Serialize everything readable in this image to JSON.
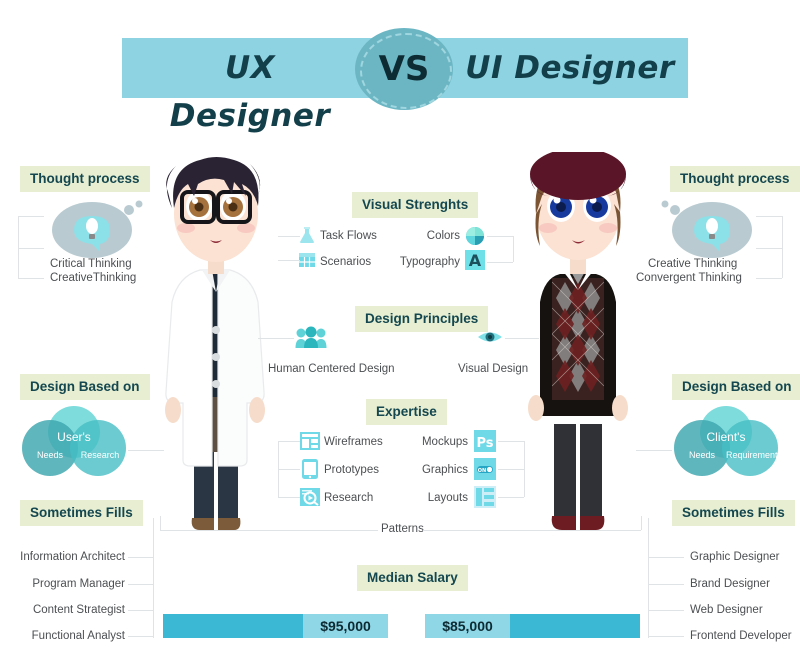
{
  "header": {
    "left_title": "UX Designer",
    "right_title": "UI Designer",
    "vs": "VS",
    "bar_color": "#8ed3e2",
    "circle_color": "#6cb6c4"
  },
  "chips": {
    "thought_process_left": "Thought process",
    "thought_process_right": "Thought process",
    "visual_strengths": "Visual Strenghts",
    "design_principles": "Design Principles",
    "design_based_on_left": "Design Based on",
    "design_based_on_right": "Design Based on",
    "expertise": "Expertise",
    "sometimes_fills_left": "Sometimes Fills",
    "sometimes_fills_right": "Sometimes Fills",
    "median_salary": "Median Salary",
    "chip_bg": "#e7eed1",
    "chip_text": "#14474f"
  },
  "thought_process": {
    "left_items": [
      "Critical Thinking",
      "CreativeThinking"
    ],
    "right_items": [
      "Creative Thinking",
      "Convergent Thinking"
    ]
  },
  "visual_strengths": {
    "left_items": [
      {
        "label": "Task Flows",
        "icon": "flask-icon"
      },
      {
        "label": "Scenarios",
        "icon": "grid-icon"
      }
    ],
    "right_items": [
      {
        "label": "Colors",
        "icon": "color-wheel-icon"
      },
      {
        "label": "Typography",
        "icon": "letter-a-icon"
      }
    ]
  },
  "design_principles": {
    "left_item": {
      "label": "Human Centered Design",
      "icon": "people-group-icon"
    },
    "right_item": {
      "label": "Visual Design",
      "icon": "eye-icon"
    }
  },
  "design_based_on": {
    "left_venn": {
      "main": "User's",
      "a": "Needs",
      "b": "Research"
    },
    "right_venn": {
      "main": "Client's",
      "a": "Needs",
      "b": "Requirements"
    }
  },
  "expertise": {
    "left_items": [
      {
        "label": "Wireframes",
        "icon": "wireframe-icon"
      },
      {
        "label": "Prototypes",
        "icon": "mobile-icon"
      },
      {
        "label": "Research",
        "icon": "magnifier-icon"
      }
    ],
    "right_items": [
      {
        "label": "Mockups",
        "icon": "photoshop-icon"
      },
      {
        "label": "Graphics",
        "icon": "toggle-on-icon"
      },
      {
        "label": "Layouts",
        "icon": "layout-icon"
      }
    ],
    "shared_item": "Patterns"
  },
  "sometimes_fills": {
    "left_items": [
      "Information Architect",
      "Program Manager",
      "Content Strategist",
      "Functional Analyst"
    ],
    "right_items": [
      "Graphic Designer",
      "Brand Designer",
      "Web Designer",
      "Frontend Developer"
    ]
  },
  "chart_data": {
    "type": "bar",
    "title": "Median Salary",
    "categories": [
      "UX Designer",
      "UI Designer"
    ],
    "values": [
      95000,
      85000
    ],
    "value_labels": [
      "$95,000",
      "$85,000"
    ],
    "xlabel": "",
    "ylabel": "",
    "orientation": "horizontal",
    "bar_color": "#3bb8d4",
    "label_bg_color": "#8fd6e6",
    "grid": false,
    "legend": "none"
  },
  "colors": {
    "accent_teal": "#3bb8d4",
    "light_teal": "#8fd6e6",
    "dark_teal_text": "#14474f",
    "line_gray": "#dfe3e6",
    "body_text": "#4c4f52"
  }
}
